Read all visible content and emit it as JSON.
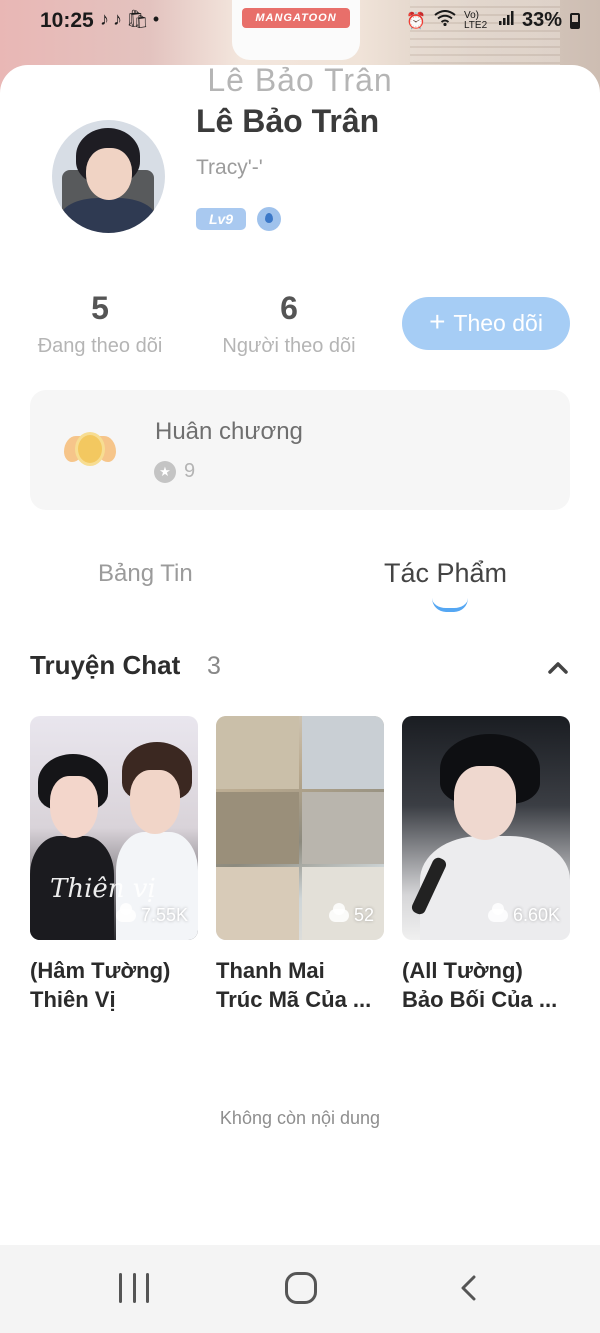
{
  "status_bar": {
    "time": "10:25",
    "notification_icons": [
      "tiktok-icon",
      "tiktok-icon",
      "shopee-icon",
      "dot-icon"
    ],
    "network": "Vo) LTE2",
    "battery": "33%"
  },
  "banner": {
    "logo_text": "MANGATOON"
  },
  "header": {
    "title": "Lê Bảo Trân"
  },
  "profile": {
    "name": "Lê Bảo Trân",
    "handle": "Tracy'-'",
    "level": "Lv9"
  },
  "stats": {
    "following_count": "5",
    "following_label": "Đang theo dõi",
    "followers_count": "6",
    "followers_label": "Người theo dõi"
  },
  "follow_button": {
    "icon": "+",
    "label": "Theo dõi"
  },
  "medals": {
    "title": "Huân chương",
    "count": "9"
  },
  "tabs": [
    {
      "label": "Bảng Tin",
      "active": false
    },
    {
      "label": "Tác Phẩm",
      "active": true
    }
  ],
  "section": {
    "title": "Truyện Chat",
    "count": "3"
  },
  "stories": [
    {
      "line1": "(Hâm Tường)",
      "line2": "Thiên Vị",
      "views": "7.55K",
      "cover_text": "Thiên vị"
    },
    {
      "line1": "Thanh Mai",
      "line2": "Trúc Mã Của ...",
      "views": "52"
    },
    {
      "line1": "(All Tường)",
      "line2": "Bảo Bối Của ...",
      "views": "6.60K"
    }
  ],
  "footer_text": "Không còn nội dung",
  "colors": {
    "accent": "#55a7f3",
    "follow_button_bg": "#a6cdf5",
    "level_badge_bg": "#a9c9f0"
  }
}
